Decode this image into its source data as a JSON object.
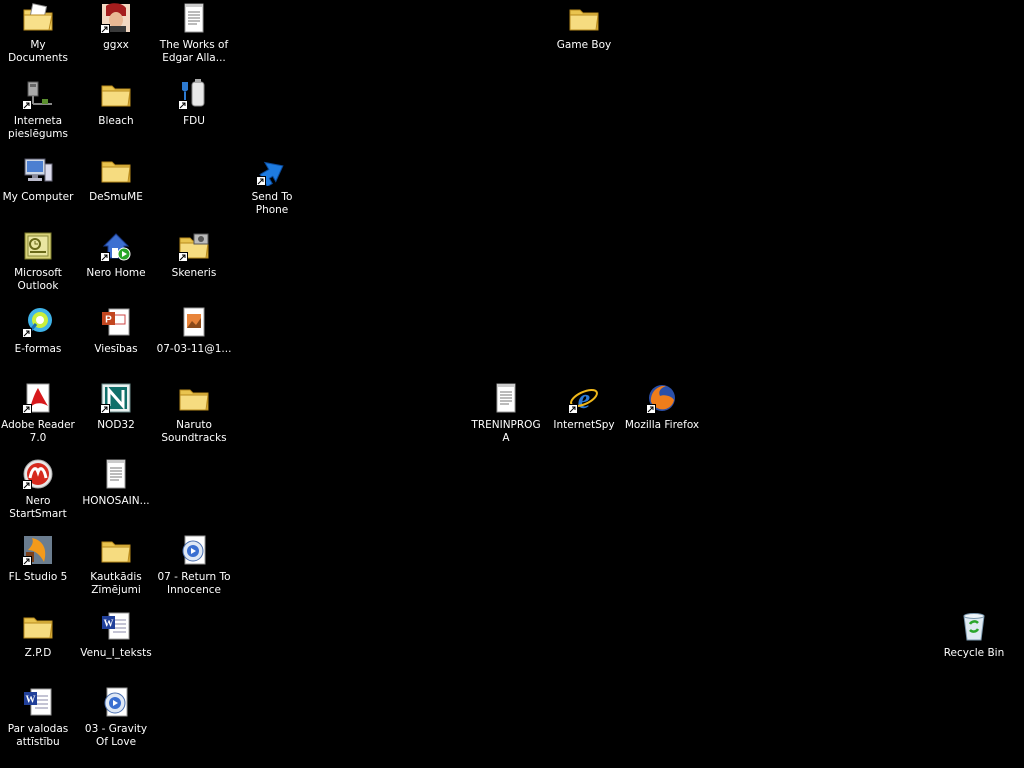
{
  "desktop": {
    "background_color": "#000000",
    "label_color": "#ffffff",
    "icons": {
      "my_documents": {
        "label": "My Documents",
        "icon": "folder-documents-icon"
      },
      "ggxx": {
        "label": "ggxx",
        "icon": "game-character-icon"
      },
      "works_edgar": {
        "label": "The Works of Edgar Alla...",
        "icon": "text-document-icon"
      },
      "game_boy": {
        "label": "Game Boy",
        "icon": "folder-icon"
      },
      "interneta": {
        "label": "Interneta pieslēgums",
        "icon": "network-connection-icon"
      },
      "bleach": {
        "label": "Bleach",
        "icon": "folder-icon"
      },
      "fdu": {
        "label": "FDU",
        "icon": "usb-tool-icon"
      },
      "my_computer": {
        "label": "My Computer",
        "icon": "computer-icon"
      },
      "desmume": {
        "label": "DeSmuME",
        "icon": "folder-icon"
      },
      "send_to_phone": {
        "label": "Send To Phone",
        "icon": "send-arrow-icon"
      },
      "outlook": {
        "label": "Microsoft Outlook",
        "icon": "outlook-icon"
      },
      "nero_home": {
        "label": "Nero Home",
        "icon": "nero-home-icon"
      },
      "skeneris": {
        "label": "Skeneris",
        "icon": "scanner-folder-icon"
      },
      "e_formas": {
        "label": "E-formas",
        "icon": "e-forms-icon"
      },
      "viesibas": {
        "label": "Viesības",
        "icon": "powerpoint-icon"
      },
      "photo_070311": {
        "label": "07-03-11@1...",
        "icon": "image-file-icon"
      },
      "treninproga": {
        "label": "TRENINPROGA",
        "icon": "text-document-icon"
      },
      "internetspy": {
        "label": "InternetSpy",
        "icon": "internet-explorer-icon"
      },
      "firefox": {
        "label": "Mozilla Firefox",
        "icon": "firefox-icon"
      },
      "adobe_reader": {
        "label": "Adobe Reader 7.0",
        "icon": "adobe-reader-icon"
      },
      "nod32": {
        "label": "NOD32",
        "icon": "nod32-icon"
      },
      "naruto": {
        "label": "Naruto Soundtracks",
        "icon": "folder-icon"
      },
      "nero_startsmart": {
        "label": "Nero StartSmart",
        "icon": "nero-icon"
      },
      "honosain": {
        "label": "HONOSAIN...",
        "icon": "text-document-icon"
      },
      "fl_studio": {
        "label": "FL Studio 5",
        "icon": "fl-studio-icon"
      },
      "kautkadis": {
        "label": "Kautkādis Zīmējumi",
        "icon": "folder-icon"
      },
      "return_innocence": {
        "label": "07 - Return To Innocence",
        "icon": "media-file-icon"
      },
      "zpd": {
        "label": "Z.P.D",
        "icon": "folder-icon"
      },
      "venu_teksts": {
        "label": "Venu_I_teksts",
        "icon": "word-document-icon"
      },
      "recycle_bin": {
        "label": "Recycle Bin",
        "icon": "recycle-bin-icon"
      },
      "par_valodas": {
        "label": "Par valodas attīstību",
        "icon": "word-document-icon"
      },
      "gravity_love": {
        "label": "03 - Gravity Of Love",
        "icon": "media-file-icon"
      }
    }
  }
}
